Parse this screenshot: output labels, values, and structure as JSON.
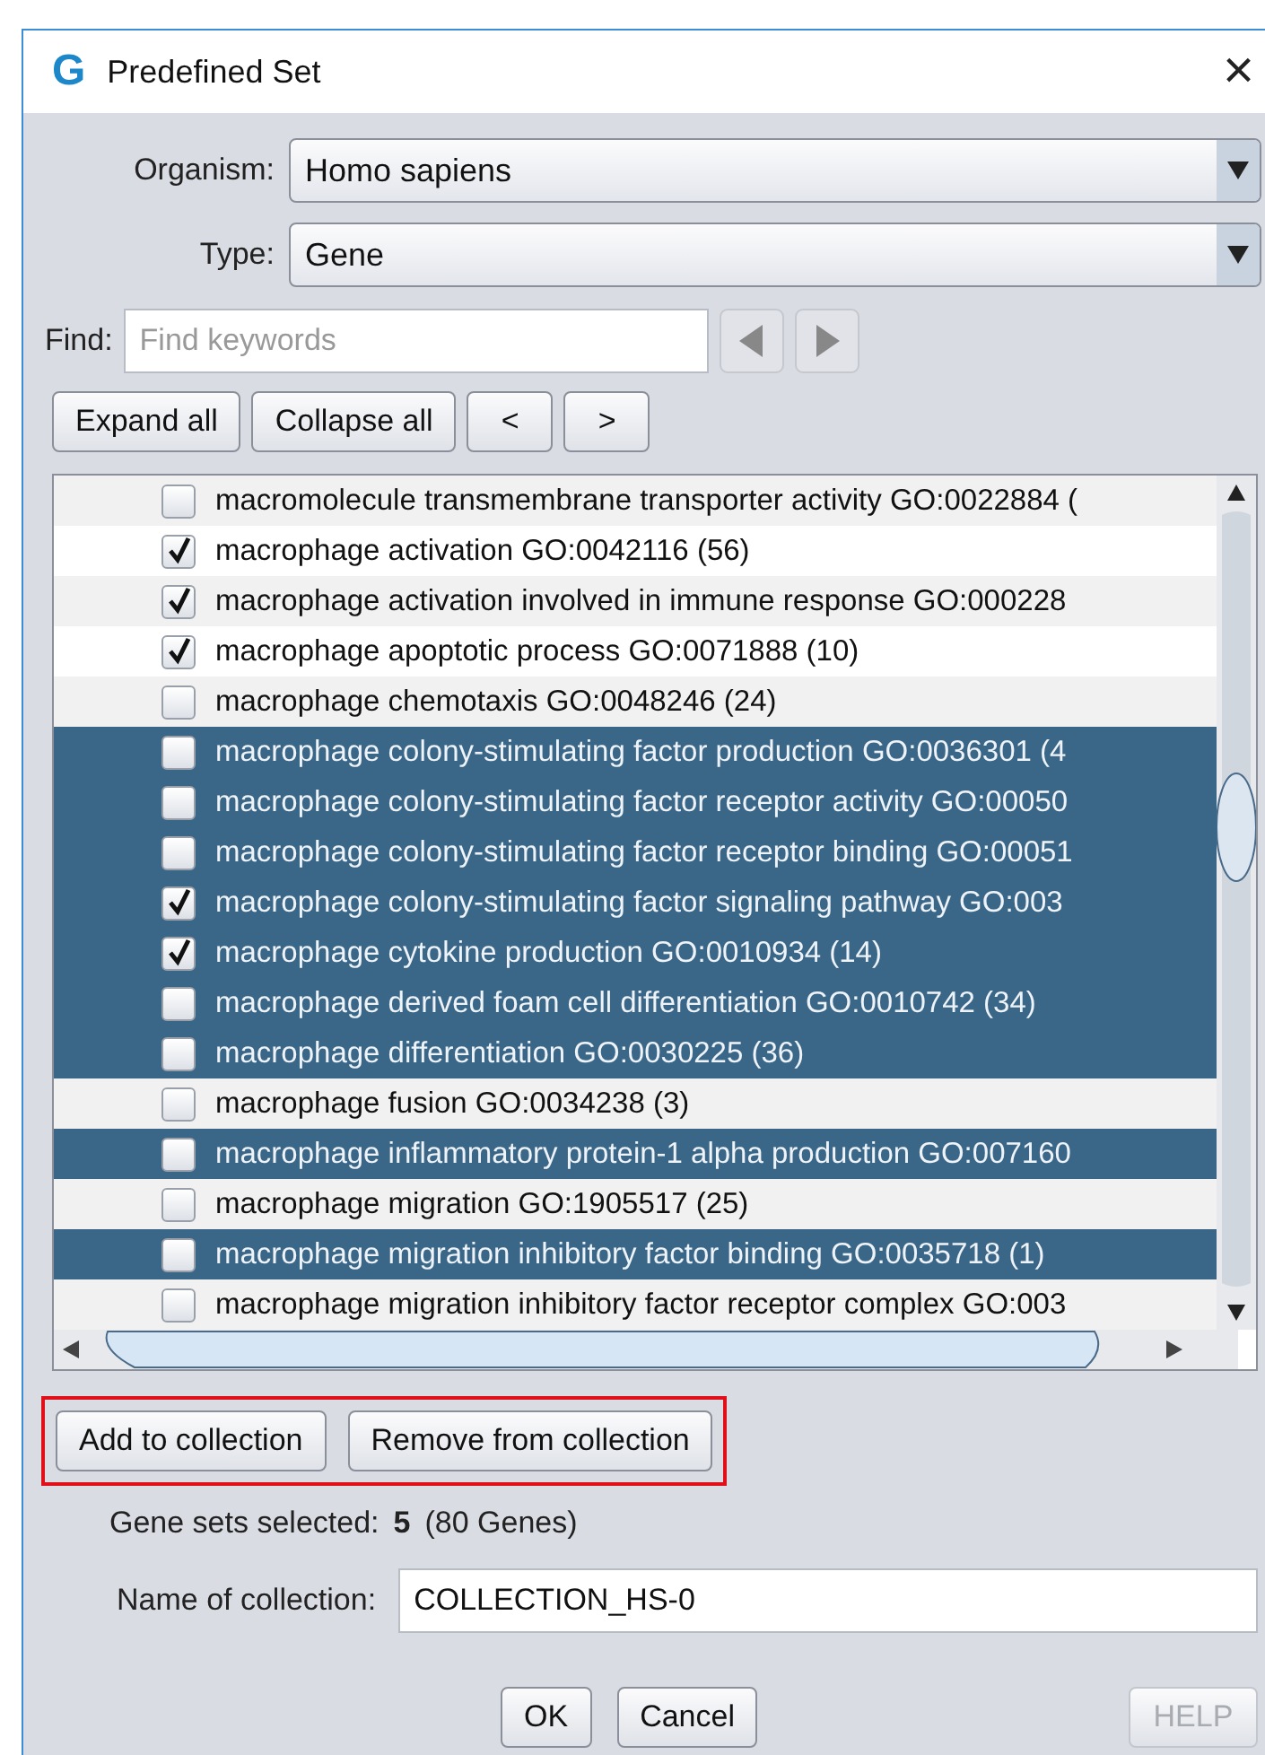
{
  "window": {
    "logo": "G",
    "title": "Predefined Set",
    "close": "×"
  },
  "organism": {
    "label": "Organism:",
    "value": "Homo sapiens"
  },
  "type": {
    "label": "Type:",
    "value": "Gene"
  },
  "find": {
    "label": "Find:",
    "placeholder": "Find keywords"
  },
  "tree_buttons": [
    "Expand all",
    "Collapse all",
    "<",
    ">"
  ],
  "gene_sets": [
    {
      "text": "macromolecule transmembrane transporter activity  GO:0022884 (",
      "checked": false,
      "selected": false
    },
    {
      "text": "macrophage activation  GO:0042116 (56)",
      "checked": true,
      "selected": false
    },
    {
      "text": "macrophage activation involved in immune response  GO:000228",
      "checked": true,
      "selected": false
    },
    {
      "text": "macrophage apoptotic process  GO:0071888 (10)",
      "checked": true,
      "selected": false
    },
    {
      "text": "macrophage chemotaxis  GO:0048246 (24)",
      "checked": false,
      "selected": false
    },
    {
      "text": "macrophage colony-stimulating factor production  GO:0036301 (4",
      "checked": false,
      "selected": true
    },
    {
      "text": "macrophage colony-stimulating factor receptor activity  GO:00050",
      "checked": false,
      "selected": true
    },
    {
      "text": "macrophage colony-stimulating factor receptor binding  GO:00051",
      "checked": false,
      "selected": true
    },
    {
      "text": "macrophage colony-stimulating factor signaling pathway  GO:003",
      "checked": true,
      "selected": true
    },
    {
      "text": "macrophage cytokine production  GO:0010934 (14)",
      "checked": true,
      "selected": true
    },
    {
      "text": "macrophage derived foam cell differentiation  GO:0010742 (34)",
      "checked": false,
      "selected": true
    },
    {
      "text": "macrophage differentiation  GO:0030225 (36)",
      "checked": false,
      "selected": true
    },
    {
      "text": "macrophage fusion  GO:0034238 (3)",
      "checked": false,
      "selected": false
    },
    {
      "text": "macrophage inflammatory protein-1 alpha production  GO:007160",
      "checked": false,
      "selected": true
    },
    {
      "text": "macrophage migration  GO:1905517 (25)",
      "checked": false,
      "selected": false
    },
    {
      "text": "macrophage migration inhibitory factor binding  GO:0035718 (1)",
      "checked": false,
      "selected": true
    },
    {
      "text": "macrophage migration inhibitory factor receptor complex  GO:003",
      "checked": false,
      "selected": false
    }
  ],
  "collection_buttons": {
    "highlighted": true,
    "buttons": [
      "Add to collection",
      "Remove from collection"
    ]
  },
  "summary": {
    "label": "Gene sets selected:",
    "count": "5",
    "genes": "(80 Genes)"
  },
  "collection_name": {
    "label": "Name of collection:",
    "value": "COLLECTION_HS-0"
  },
  "dialog_buttons": [
    {
      "label": "OK",
      "kind": "default",
      "disabled": false
    },
    {
      "label": "Cancel",
      "kind": "normal",
      "disabled": false
    },
    {
      "label": "HELP",
      "kind": "help",
      "disabled": true
    }
  ]
}
